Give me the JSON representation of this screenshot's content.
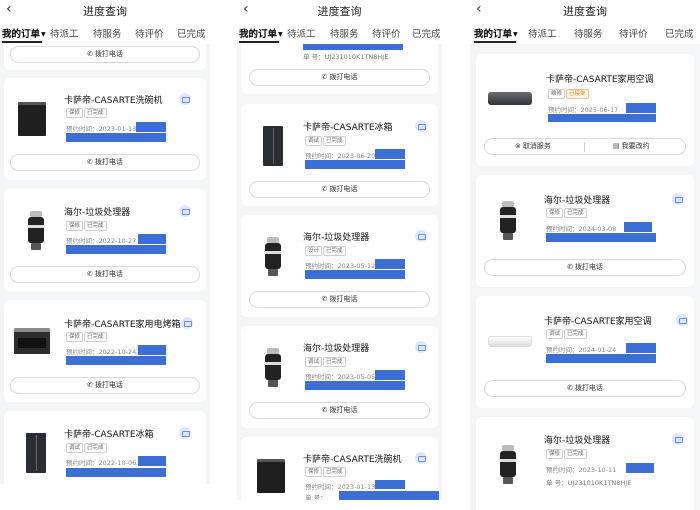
{
  "nav": {
    "title": "进度查询",
    "back_icon": "chevron-left-icon"
  },
  "tabs": [
    "我的订单",
    "待派工",
    "待服务",
    "待评价",
    "已完成"
  ],
  "common": {
    "call_button": "拨打电话",
    "phone_icon": "phone-icon"
  },
  "screen1": {
    "cards": [
      {
        "name": "卡萨帝-CASARTE洗碗机",
        "tags": [
          "保修",
          "已完成"
        ],
        "date": "预约时间：2023-01-13"
      },
      {
        "name": "海尔-垃圾处理器",
        "tags": [
          "保修",
          "已完成"
        ],
        "date": "预约时间：2022-10-27"
      },
      {
        "name": "卡萨帝-CASARTE家用电烤箱",
        "tags": [
          "保修",
          "已完成"
        ],
        "date": "预约时间：2022-10-24"
      },
      {
        "name": "卡萨帝-CASARTE冰箱",
        "tags": [
          "调试",
          "已完成"
        ],
        "date": "预约时间：2022-10-06"
      }
    ]
  },
  "screen2": {
    "top_sn": "单    号：UJ231010K1TN8HJE",
    "cards": [
      {
        "name": "卡萨帝-CASARTE冰箱",
        "tags": [
          "调试",
          "已完成"
        ],
        "date": "预约时间：2023-06-20"
      },
      {
        "name": "海尔-垃圾处理器",
        "tags": [
          "设计",
          "已完成"
        ],
        "date": "预约时间：2023-05-12"
      },
      {
        "name": "海尔-垃圾处理器",
        "tags": [
          "调试",
          "已完成"
        ],
        "date": "预约时间：2023-05-05"
      },
      {
        "name": "卡萨帝-CASARTE洗碗机",
        "tags": [
          "保修",
          "已完成"
        ],
        "date": "预约时间：2023-01-13",
        "sn": "单    号："
      }
    ]
  },
  "screen3": {
    "cards": [
      {
        "name": "卡萨帝-CASARTE家用空调",
        "tags": [
          "维修",
          "已接单"
        ],
        "date": "预约时间：2025-06-17",
        "cancel": "取消服务",
        "reschedule": "我要改约"
      },
      {
        "name": "海尔-垃圾处理器",
        "tags": [
          "保修",
          "已完成"
        ],
        "date": "预约时间：2024-03-08"
      },
      {
        "name": "卡萨帝-CASARTE家用空调",
        "tags": [
          "调试",
          "已完成"
        ],
        "date": "预约时间：2024-01-24"
      },
      {
        "name": "海尔-垃圾处理器",
        "tags": [
          "保修",
          "已完成"
        ],
        "date": "预约时间：2023-10-11",
        "sn": "单    号：UJ231010K1TN8HJE"
      }
    ]
  },
  "colors": {
    "redaction": "#3b6fd6",
    "accent_orange": "#e38a1e",
    "background": "#f4f5f7"
  }
}
